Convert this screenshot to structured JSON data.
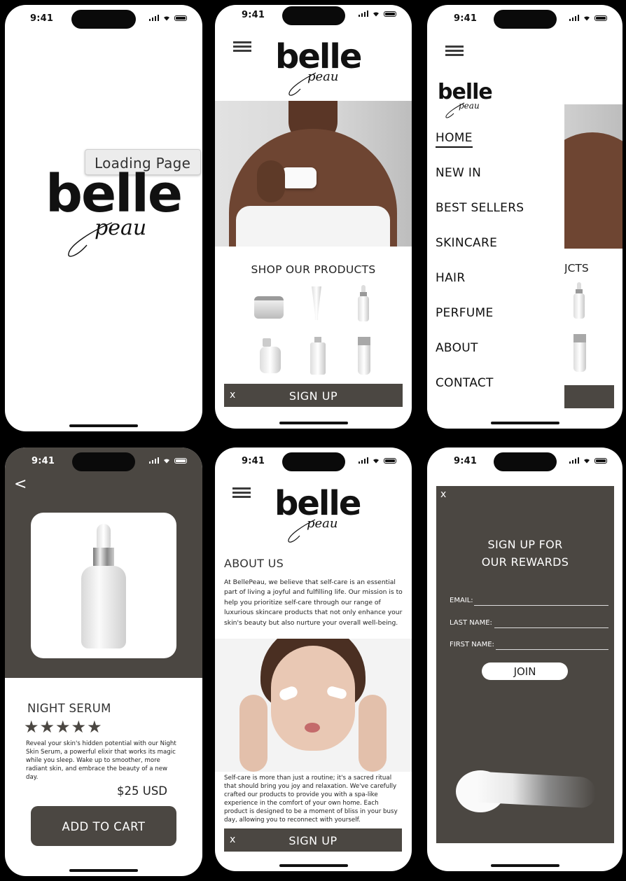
{
  "status": {
    "time": "9:41"
  },
  "brand": {
    "name": "belle",
    "script": "peau"
  },
  "loading": {
    "tooltip": "Loading Page"
  },
  "home": {
    "shop_title": "SHOP OUR PRODUCTS",
    "signup_close": "x",
    "signup_label": "SIGN UP"
  },
  "menu": {
    "items": [
      "HOME",
      "NEW IN",
      "BEST SELLERS",
      "SKINCARE",
      "HAIR",
      "PERFUME",
      "ABOUT",
      "CONTACT"
    ],
    "peek_text": "JCTS"
  },
  "product": {
    "back": "<",
    "name": "NIGHT SERUM",
    "stars": "★★★★★",
    "rating": 5,
    "description": "Reveal your skin's hidden potential with our Night Skin Serum, a powerful elixir that works its magic while you sleep. Wake up to smoother, more radiant skin, and embrace the beauty of a new day.",
    "price": "$25 USD",
    "cta": "ADD TO CART"
  },
  "about": {
    "title": "ABOUT US",
    "intro": "At BellePeau, we believe that self-care is an essential part of living a joyful and fulfilling life. Our mission is to help you prioritize self-care through our range of luxurious skincare products that not only enhance your skin's beauty but also nurture your overall well-being.",
    "body": "Self-care is more than just a routine; it's a sacred ritual that should bring you joy and relaxation. We've carefully crafted our products to provide you with a spa-like experience in the comfort of your own home. Each product is designed to be a moment of bliss in your busy day, allowing you to reconnect with yourself.",
    "signup_close": "x",
    "signup_label": "SIGN UP"
  },
  "rewards": {
    "close": "x",
    "title_line1": "SIGN UP FOR",
    "title_line2": "OUR REWARDS",
    "email_label": "EMAIL:",
    "last_name_label": "LAST NAME:",
    "first_name_label": "FIRST NAME:",
    "join": "JOIN"
  },
  "colors": {
    "brand_brown": "#4b4742",
    "skin": "#6e4532",
    "background": "#ffffff"
  }
}
